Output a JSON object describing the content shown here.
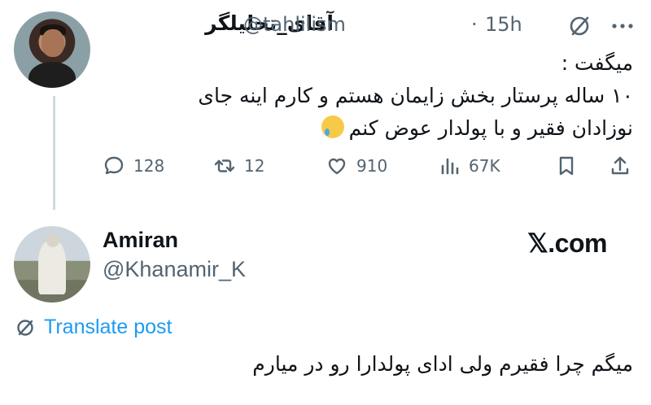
{
  "tweet": {
    "display_name": "آقای_تحلیلگر",
    "handle": "@tahlilism",
    "separator": "·",
    "time": "15h",
    "lines": [
      "میگفت :",
      "۱۰ ساله پرستار بخش زایمان هستم و کارم اینه جای",
      "نوزادان فقیر و با پولدار عوض کنم"
    ],
    "emoji": "face-holding-back-tears",
    "actions": {
      "replies": "128",
      "reposts": "12",
      "likes": "910",
      "views": "67K"
    }
  },
  "reply": {
    "display_name": "Amiran",
    "handle": "@Khanamir_K",
    "watermark": "𝕏.com",
    "translate_label": "Translate post",
    "text": "میگم چرا فقیرم ولی ادای پولدارا رو در میارم"
  },
  "colors": {
    "text_primary": "#0f1419",
    "text_secondary": "#536471",
    "link": "#1d9bf0",
    "thread_line": "#cfd9de"
  },
  "icons": [
    "grok-icon",
    "more-icon",
    "reply-icon",
    "repost-icon",
    "like-icon",
    "views-icon",
    "bookmark-icon",
    "share-icon",
    "translate-icon"
  ]
}
